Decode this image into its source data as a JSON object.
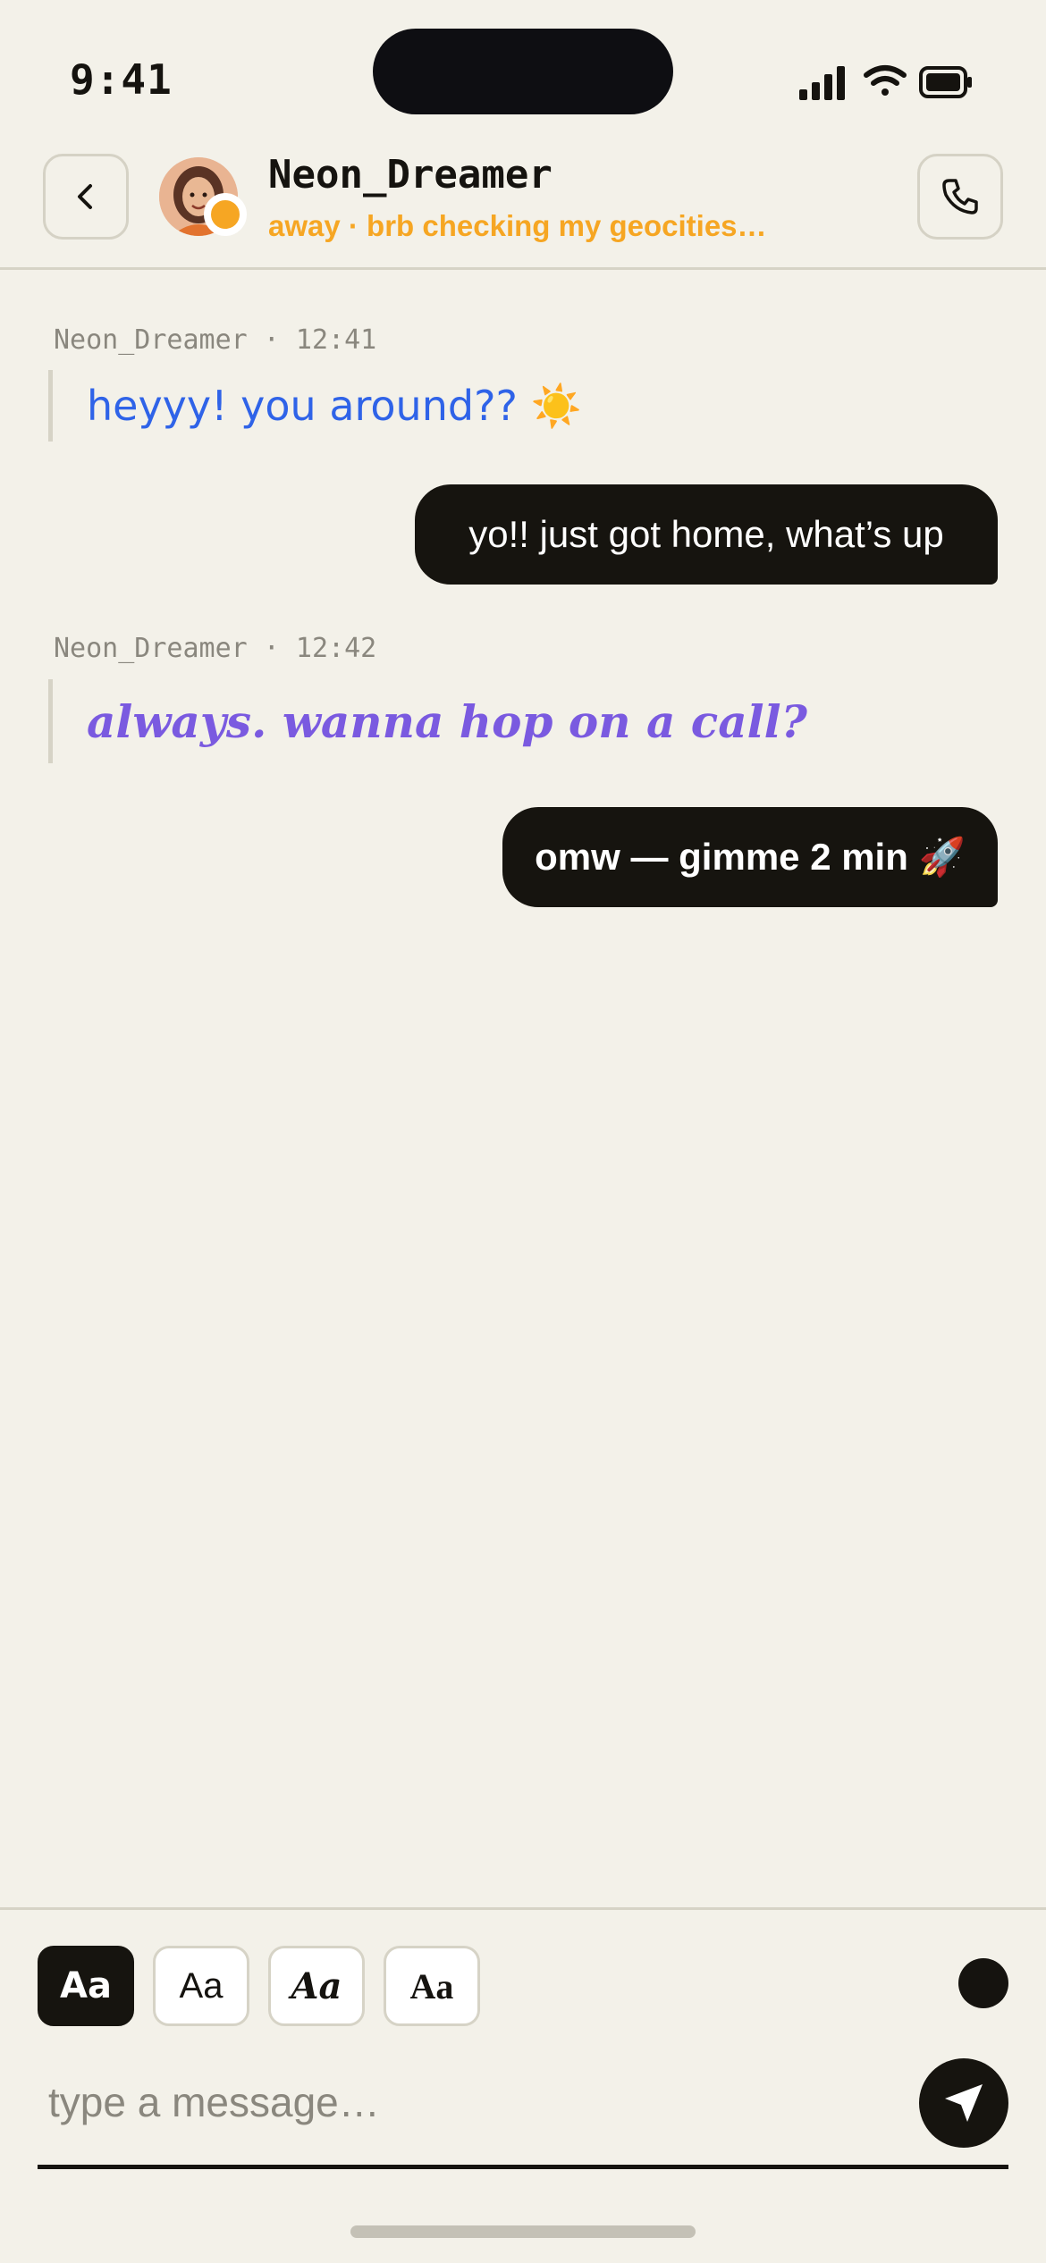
{
  "status_bar": {
    "time": "9:41"
  },
  "header": {
    "back_icon": "chevron-left-icon",
    "contact_name": "Neon_Dreamer",
    "contact_status": "away · brb checking my geocities…",
    "status_color": "#f6a623",
    "call_icon": "phone-icon"
  },
  "messages": [
    {
      "direction": "incoming",
      "sender": "Neon_Dreamer",
      "meta": "Neon_Dreamer · 12:41",
      "text": "heyyy! you around?? ☀️",
      "color": "#2f63e8"
    },
    {
      "direction": "outgoing",
      "text": "yo!! just got home, what’s up"
    },
    {
      "direction": "incoming",
      "sender": "Neon_Dreamer",
      "meta": "Neon_Dreamer · 12:42",
      "text": "always. wanna hop on a call?",
      "color": "#7a5ae0"
    },
    {
      "direction": "outgoing",
      "text": "omw — gimme 2 min 🚀"
    }
  ],
  "composer": {
    "font_options": [
      {
        "label": "Aa",
        "active": true
      },
      {
        "label": "Aa",
        "active": false
      },
      {
        "label": "Aa",
        "active": false
      },
      {
        "label": "Aa",
        "active": false
      }
    ],
    "color_swatch": "#15130f",
    "input_value": "",
    "placeholder": "type a message…",
    "send_icon": "send-icon"
  }
}
